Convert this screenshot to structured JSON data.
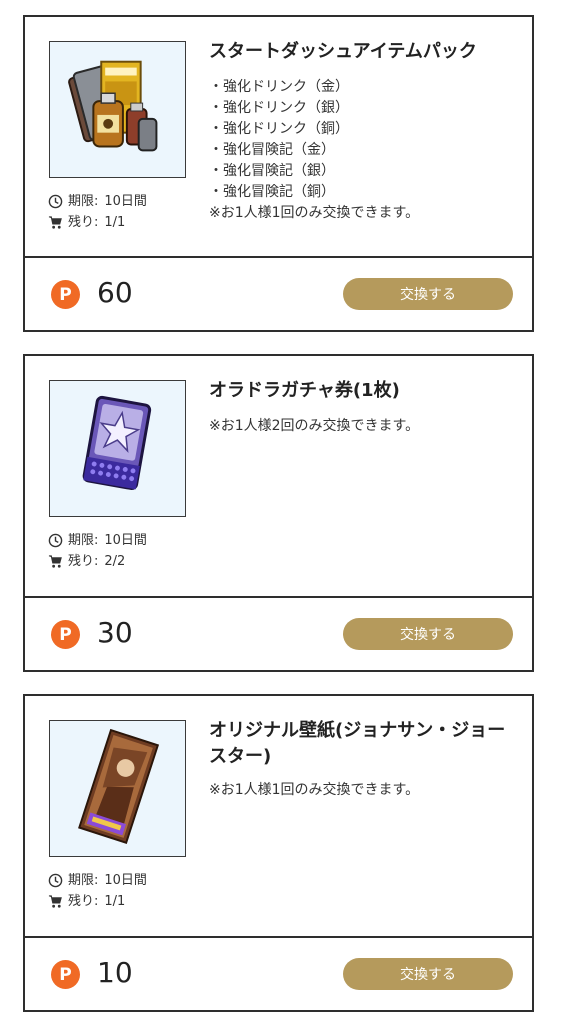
{
  "items": [
    {
      "title": "スタートダッシュアイテムパック",
      "contents": [
        "・強化ドリンク（金）",
        "・強化ドリンク（銀）",
        "・強化ドリンク（銅）",
        "・強化冒険記（金）",
        "・強化冒険記（銀）",
        "・強化冒険記（銅）"
      ],
      "note": "※お1人様1回のみ交換できます。",
      "period_label": "期限:",
      "period_value": "10日間",
      "remaining_label": "残り:",
      "remaining_value": "1/1",
      "points": "60",
      "coin_letter": "P",
      "button_label": "交換する"
    },
    {
      "title": "オラドラガチャ券(1枚)",
      "contents": [],
      "note": "※お1人様2回のみ交換できます。",
      "period_label": "期限:",
      "period_value": "10日間",
      "remaining_label": "残り:",
      "remaining_value": "2/2",
      "points": "30",
      "coin_letter": "P",
      "button_label": "交換する"
    },
    {
      "title": "オリジナル壁紙(ジョナサン・ジョースター)",
      "contents": [],
      "note": "※お1人様1回のみ交換できます。",
      "period_label": "期限:",
      "period_value": "10日間",
      "remaining_label": "残り:",
      "remaining_value": "1/1",
      "points": "10",
      "coin_letter": "P",
      "button_label": "交換する"
    }
  ],
  "colors": {
    "border": "#2e2e2e",
    "button": "#b59a5c",
    "coin": "#f06a25",
    "thumb_bg": "#ecf6fd"
  }
}
